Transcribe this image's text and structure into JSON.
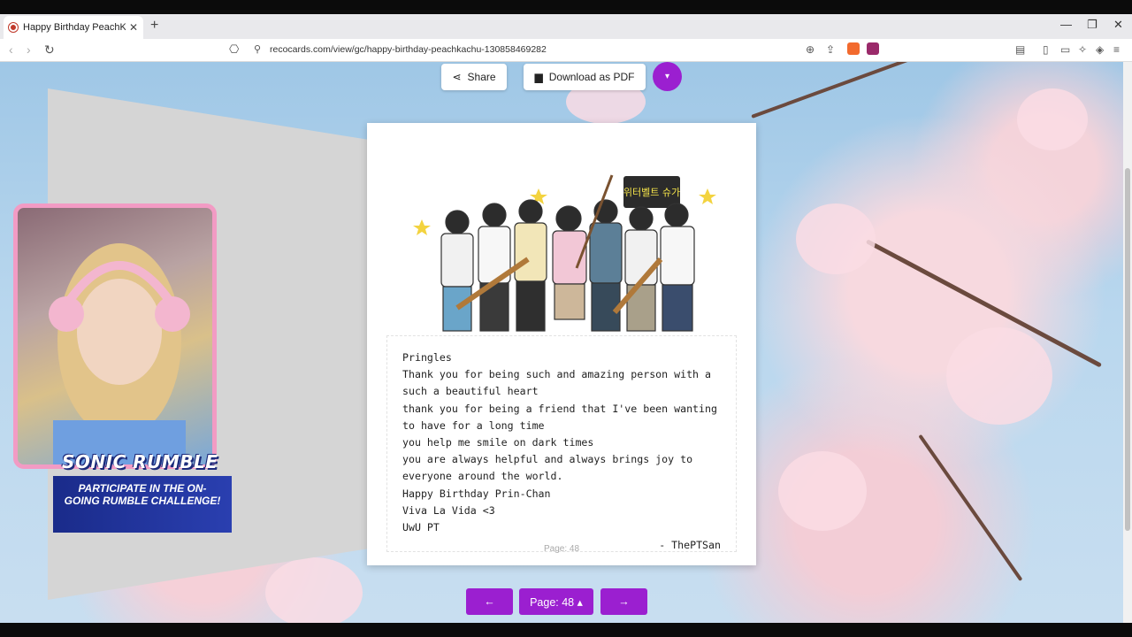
{
  "browser": {
    "tab_title": "Happy Birthday PeachKachu! | R",
    "url": "recocards.com/view/gc/happy-birthday-peachkachu-130858469282",
    "icons": [
      "back-icon",
      "forward-icon",
      "reload-icon",
      "bookmark-icon",
      "site-info-icon",
      "zoom-icon",
      "share-icon",
      "brave-shield-icon",
      "brave-rewards-icon"
    ]
  },
  "toolbar": {
    "share_label": "Share",
    "download_label": "Download as PDF",
    "more_icon": "▾"
  },
  "card": {
    "message_lines": [
      "Pringles",
      "Thank you for being such and amazing person with a",
      "such a beautiful heart",
      "thank you for being a friend that I've been wanting",
      "to have for a long time",
      "you help me smile on dark times",
      "you are always helpful and always brings joy to",
      "everyone around the world.",
      "Happy Birthday Prin-Chan",
      "Viva La Vida <3",
      "UwU PT"
    ],
    "signature": "- ThePTSan",
    "page_footer": "Page: 48",
    "image_sign_text": "위터벨트 슈가"
  },
  "pager": {
    "prev_label": "←",
    "page_label": "Page: 48 ▴",
    "next_label": "→"
  },
  "overlay": {
    "title": "SONIC RUMBLE",
    "subtitle": "PARTICIPATE IN THE ON-GOING RUMBLE CHALLENGE!"
  },
  "colors": {
    "accent_purple": "#9b1fd0",
    "webcam_border": "#f29bc4",
    "overlay_blue": "#1a2b8a"
  }
}
